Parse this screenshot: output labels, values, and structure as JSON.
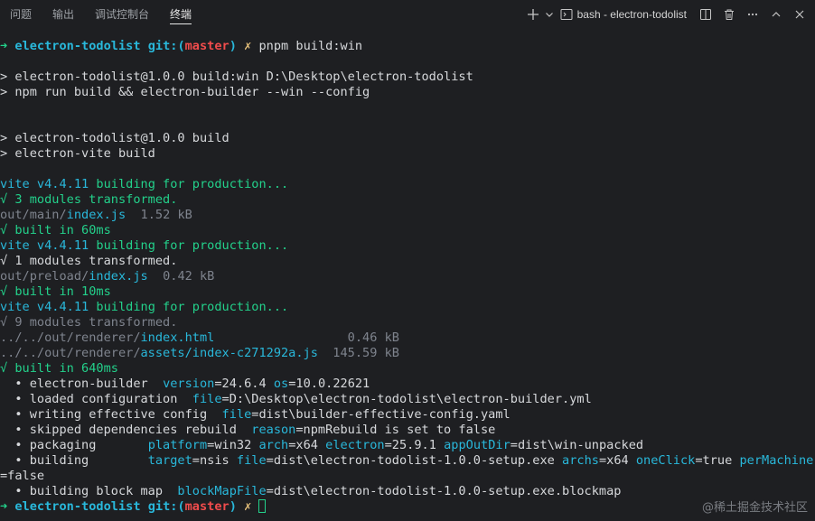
{
  "tabs": [
    {
      "label": "问题"
    },
    {
      "label": "输出"
    },
    {
      "label": "调试控制台"
    },
    {
      "label": "终端",
      "active": true
    }
  ],
  "toolbar": {
    "terminal_name": "bash - electron-todolist",
    "icons": [
      "plus-icon",
      "chevron-down-icon",
      "terminal-icon",
      "split-icon",
      "trash-icon",
      "ellipsis-icon",
      "chevron-up-icon",
      "close-icon"
    ]
  },
  "prompt": {
    "arrow": "➜",
    "dir": "electron-todolist",
    "git": "git:(",
    "branch": "master",
    "git_close": ")",
    "dirty": "✗",
    "command": "pnpm build:win"
  },
  "lines": {
    "l1": "> electron-todolist@1.0.0 build:win D:\\Desktop\\electron-todolist",
    "l2": "> npm run build && electron-builder --win --config",
    "l3": "> electron-todolist@1.0.0 build",
    "l4": "> electron-vite build",
    "vite": "vite v4.4.11",
    "building": " building for production...",
    "main_transformed": "√ 3 modules transformed.",
    "main_path": "out/main/",
    "main_file": "index.js",
    "main_size": "  1.52 kB",
    "main_built": "√ built in 60ms",
    "preload_transformed": "√ 1 modules transformed.",
    "preload_path": "out/preload/",
    "preload_file": "index.js",
    "preload_size": "  0.42 kB",
    "preload_built": "√ built in 10ms",
    "renderer_transformed": "√ 9 modules transformed.",
    "renderer_path": "../../out/renderer/",
    "renderer_html": "index.html",
    "renderer_html_size": "                  0.46 kB",
    "renderer_assets": "assets/index-c271292a.js",
    "renderer_assets_size": "  145.59 kB",
    "renderer_built": "√ built in 640ms",
    "eb1_key": "  • electron-builder  ",
    "eb1_v_k": "version",
    "eb1_v_v": "=24.6.4 ",
    "eb1_os_k": "os",
    "eb1_os_v": "=10.0.22621",
    "eb2_key": "  • loaded configuration  ",
    "eb2_k": "file",
    "eb2_v": "=D:\\Desktop\\electron-todolist\\electron-builder.yml",
    "eb3_key": "  • writing effective config  ",
    "eb3_k": "file",
    "eb3_v": "=dist\\builder-effective-config.yaml",
    "eb4_key": "  • skipped dependencies rebuild  ",
    "eb4_k": "reason",
    "eb4_v": "=npmRebuild is set to false",
    "eb5_key": "  • packaging       ",
    "eb5_k1": "platform",
    "eb5_v1": "=win32 ",
    "eb5_k2": "arch",
    "eb5_v2": "=x64 ",
    "eb5_k3": "electron",
    "eb5_v3": "=25.9.1 ",
    "eb5_k4": "appOutDir",
    "eb5_v4": "=dist\\win-unpacked",
    "eb6_key": "  • building        ",
    "eb6_k1": "target",
    "eb6_v1": "=nsis ",
    "eb6_k2": "file",
    "eb6_v2": "=dist\\electron-todolist-1.0.0-setup.exe ",
    "eb6_k3": "archs",
    "eb6_v3": "=x64 ",
    "eb6_k4": "oneClick",
    "eb6_v4": "=true ",
    "eb6_k5": "perMachine",
    "eb6_wrap": "=false",
    "eb7_key": "  • building block map  ",
    "eb7_k": "blockMapFile",
    "eb7_v": "=dist\\electron-todolist-1.0.0-setup.exe.blockmap"
  },
  "watermark": "@稀土掘金技术社区"
}
